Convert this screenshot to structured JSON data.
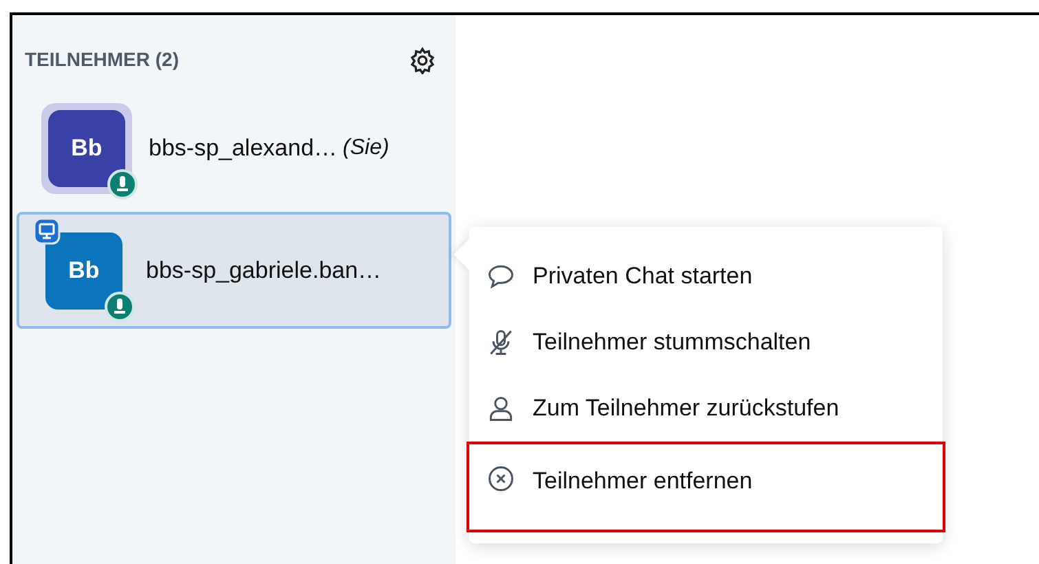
{
  "sidebar": {
    "title": "TEILNEHMER (2)",
    "participants": [
      {
        "initials": "Bb",
        "name": "bbs-sp_alexand…",
        "you_label": "(Sie)",
        "color": "#3a41a6",
        "presenter": false,
        "selected": false
      },
      {
        "initials": "Bb",
        "name": "bbs-sp_gabriele.ban…",
        "color": "#0a75bc",
        "presenter": true,
        "selected": true
      }
    ]
  },
  "context_menu": {
    "items": [
      {
        "label": "Privaten Chat starten",
        "highlighted": false
      },
      {
        "label": "Teilnehmer stummschalten",
        "highlighted": false
      },
      {
        "label": "Zum Teilnehmer zurückstufen",
        "highlighted": false
      },
      {
        "label": "Teilnehmer entfernen",
        "highlighted": true
      }
    ]
  }
}
